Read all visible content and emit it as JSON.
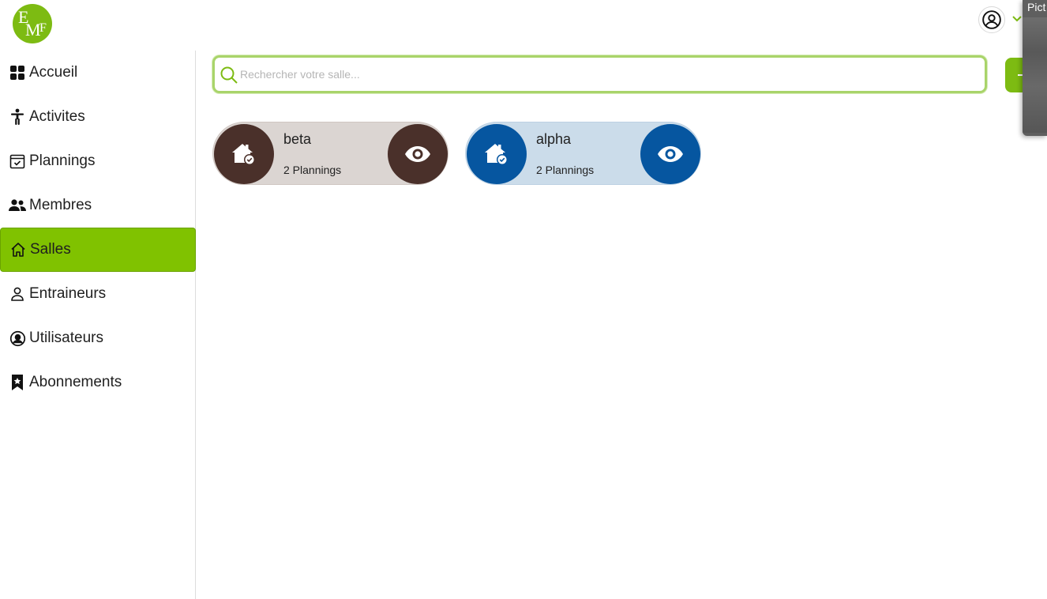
{
  "colors": {
    "brand_green": "#80c200",
    "beta_dark": "#4a302a",
    "beta_light": "#dbd5d2",
    "alpha_dark": "#0656a0",
    "alpha_light": "#cbdcea"
  },
  "header": {
    "logo_text": "EMF",
    "logo_letters": [
      "E",
      "M",
      "F"
    ],
    "user_icon": "user-circle-icon",
    "menu_icon": "chevron-down-icon"
  },
  "sidebar": {
    "items": [
      {
        "label": "Accueil",
        "icon": "grid-icon"
      },
      {
        "label": "Activites",
        "icon": "accessibility-icon"
      },
      {
        "label": "Plannings",
        "icon": "calendar-check-icon"
      },
      {
        "label": "Membres",
        "icon": "people-icon"
      },
      {
        "label": "Salles",
        "icon": "house-icon",
        "active": true
      },
      {
        "label": "Entraineurs",
        "icon": "person-icon"
      },
      {
        "label": "Utilisateurs",
        "icon": "user-circle-icon"
      },
      {
        "label": "Abonnements",
        "icon": "bookmark-star-icon"
      }
    ]
  },
  "search": {
    "placeholder": "Rechercher votre salle...",
    "value": ""
  },
  "popup": {
    "title": "Pict"
  },
  "rooms": [
    {
      "name": "beta",
      "plannings": "2 Plannings",
      "icon": "house-check-icon",
      "action_icon": "eye-icon"
    },
    {
      "name": "alpha",
      "plannings": "2 Plannings",
      "icon": "house-check-icon",
      "action_icon": "eye-icon"
    }
  ]
}
